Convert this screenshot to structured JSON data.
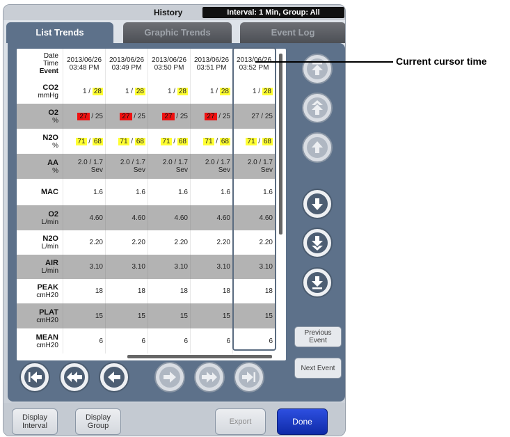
{
  "header": {
    "title": "History",
    "interval": "Interval: 1 Min, Group: All"
  },
  "tabs": [
    {
      "label": "List Trends",
      "active": true
    },
    {
      "label": "Graphic Trends",
      "active": false
    },
    {
      "label": "Event Log",
      "active": false
    }
  ],
  "table": {
    "header_labels": {
      "date": "Date",
      "time": "Time",
      "event": "Event"
    },
    "columns": [
      {
        "date": "2013/06/26",
        "time": "03:48 PM"
      },
      {
        "date": "2013/06/26",
        "time": "03:49 PM"
      },
      {
        "date": "2013/06/26",
        "time": "03:50 PM"
      },
      {
        "date": "2013/06/26",
        "time": "03:51 PM"
      },
      {
        "date": "2013/06/26",
        "time": "03:52 PM"
      }
    ],
    "rows": [
      {
        "name": "CO2",
        "unit": "mmHg",
        "values": [
          {
            "a": "1",
            "b": "28",
            "b_hl": "yellow"
          },
          {
            "a": "1",
            "b": "28",
            "b_hl": "yellow"
          },
          {
            "a": "1",
            "b": "28",
            "b_hl": "yellow"
          },
          {
            "a": "1",
            "b": "28",
            "b_hl": "yellow"
          },
          {
            "a": "1",
            "b": "28",
            "b_hl": "yellow"
          }
        ]
      },
      {
        "name": "O2",
        "unit": "%",
        "values": [
          {
            "a": "27",
            "b": "25",
            "a_hl": "red"
          },
          {
            "a": "27",
            "b": "25",
            "a_hl": "red"
          },
          {
            "a": "27",
            "b": "25",
            "a_hl": "red"
          },
          {
            "a": "27",
            "b": "25",
            "a_hl": "red"
          },
          {
            "a": "27",
            "b": "25"
          }
        ]
      },
      {
        "name": "N2O",
        "unit": "%",
        "values": [
          {
            "a": "71",
            "b": "68",
            "a_hl": "yellow",
            "b_hl": "yellow"
          },
          {
            "a": "71",
            "b": "68",
            "a_hl": "yellow",
            "b_hl": "yellow"
          },
          {
            "a": "71",
            "b": "68",
            "a_hl": "yellow",
            "b_hl": "yellow"
          },
          {
            "a": "71",
            "b": "68",
            "a_hl": "yellow",
            "b_hl": "yellow"
          },
          {
            "a": "71",
            "b": "68",
            "a_hl": "yellow",
            "b_hl": "yellow"
          }
        ]
      },
      {
        "name": "AA",
        "unit": "%",
        "values": [
          {
            "a": "2.0",
            "b": "1.7",
            "c": "Sev"
          },
          {
            "a": "2.0",
            "b": "1.7",
            "c": "Sev"
          },
          {
            "a": "2.0",
            "b": "1.7",
            "c": "Sev"
          },
          {
            "a": "2.0",
            "b": "1.7",
            "c": "Sev"
          },
          {
            "a": "2.0",
            "b": "1.7",
            "c": "Sev"
          }
        ]
      },
      {
        "name": "MAC",
        "unit": "",
        "values": [
          {
            "v": "1.6"
          },
          {
            "v": "1.6"
          },
          {
            "v": "1.6"
          },
          {
            "v": "1.6"
          },
          {
            "v": "1.6"
          }
        ]
      },
      {
        "name": "O2",
        "unit": "L/min",
        "values": [
          {
            "v": "4.60"
          },
          {
            "v": "4.60"
          },
          {
            "v": "4.60"
          },
          {
            "v": "4.60"
          },
          {
            "v": "4.60"
          }
        ]
      },
      {
        "name": "N2O",
        "unit": "L/min",
        "values": [
          {
            "v": "2.20"
          },
          {
            "v": "2.20"
          },
          {
            "v": "2.20"
          },
          {
            "v": "2.20"
          },
          {
            "v": "2.20"
          }
        ]
      },
      {
        "name": "AIR",
        "unit": "L/min",
        "values": [
          {
            "v": "3.10"
          },
          {
            "v": "3.10"
          },
          {
            "v": "3.10"
          },
          {
            "v": "3.10"
          },
          {
            "v": "3.10"
          }
        ]
      },
      {
        "name": "PEAK",
        "unit": "cmH20",
        "values": [
          {
            "v": "18"
          },
          {
            "v": "18"
          },
          {
            "v": "18"
          },
          {
            "v": "18"
          },
          {
            "v": "18"
          }
        ]
      },
      {
        "name": "PLAT",
        "unit": "cmH20",
        "values": [
          {
            "v": "15"
          },
          {
            "v": "15"
          },
          {
            "v": "15"
          },
          {
            "v": "15"
          },
          {
            "v": "15"
          }
        ]
      },
      {
        "name": "MEAN",
        "unit": "cmH20",
        "values": [
          {
            "v": "6"
          },
          {
            "v": "6"
          },
          {
            "v": "6"
          },
          {
            "v": "6"
          },
          {
            "v": "6"
          }
        ]
      }
    ]
  },
  "side_buttons": {
    "previous_event": "Previous Event",
    "next_event": "Next Event"
  },
  "bottom_buttons": {
    "display_interval": "Display Interval",
    "display_group": "Display Group",
    "export": "Export",
    "done": "Done"
  },
  "callout": {
    "label": "Current cursor time"
  },
  "colors": {
    "accent": "#5d718a",
    "done": "#1f3fd0",
    "highlight_yellow": "#ffff33",
    "highlight_red": "#ee1111"
  },
  "icons": {
    "scroll_up": [
      "page-up-icon",
      "double-up-icon",
      "up-icon"
    ],
    "scroll_down": [
      "down-icon",
      "double-down-icon",
      "page-down-icon"
    ],
    "scroll_horizontal": [
      "first-icon",
      "fast-back-icon",
      "back-icon",
      "forward-icon",
      "fast-forward-icon",
      "last-icon"
    ]
  }
}
